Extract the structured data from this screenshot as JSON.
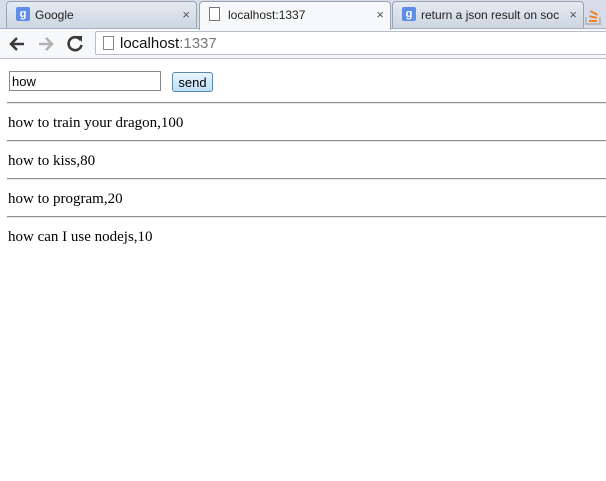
{
  "tabs": [
    {
      "title": "Google",
      "icon": "google-favicon",
      "active": false
    },
    {
      "title": "localhost:1337",
      "icon": "page-icon",
      "active": true
    },
    {
      "title": "return a json result on soc",
      "icon": "google-favicon",
      "active": false
    }
  ],
  "tab_close_glyph": "×",
  "address": {
    "host": "localhost",
    "port": ":1337"
  },
  "search": {
    "value": "how",
    "button_label": "send"
  },
  "results": [
    {
      "text": "how to train your dragon,100"
    },
    {
      "text": "how to kiss,80"
    },
    {
      "text": "how to program,20"
    },
    {
      "text": "how can I use nodejs,10"
    }
  ]
}
